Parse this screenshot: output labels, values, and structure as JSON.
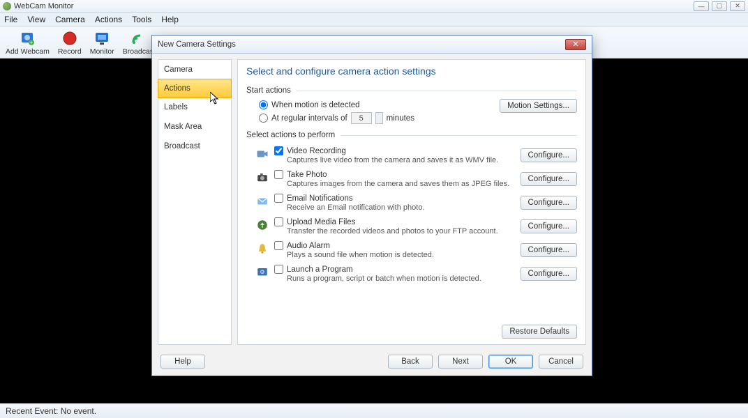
{
  "window": {
    "title": "WebCam Monitor"
  },
  "menu": {
    "file": "File",
    "view": "View",
    "camera": "Camera",
    "actions": "Actions",
    "tools": "Tools",
    "help": "Help"
  },
  "toolbar": {
    "add_webcam": "Add Webcam",
    "record": "Record",
    "monitor": "Monitor",
    "broadcast": "Broadcast"
  },
  "statusbar": {
    "recent_event": "Recent Event: No event."
  },
  "dialog": {
    "title": "New Camera Settings",
    "nav": {
      "camera": "Camera",
      "actions": "Actions",
      "labels": "Labels",
      "mask_area": "Mask Area",
      "broadcast": "Broadcast"
    },
    "heading": "Select and configure camera action settings",
    "start_actions_label": "Start actions",
    "radio_motion": "When motion is detected",
    "radio_interval_prefix": "At regular intervals of",
    "interval_value": "5",
    "radio_interval_suffix": "minutes",
    "motion_settings_btn": "Motion Settings...",
    "select_actions_label": "Select actions to perform",
    "configure_btn": "Configure...",
    "actions_list": [
      {
        "title": "Video Recording",
        "desc": "Captures live video from the camera and saves it as WMV file.",
        "checked": true
      },
      {
        "title": "Take Photo",
        "desc": "Captures images from the camera and saves them as JPEG files.",
        "checked": false
      },
      {
        "title": "Email Notifications",
        "desc": "Receive an Email notification with photo.",
        "checked": false
      },
      {
        "title": "Upload Media Files",
        "desc": "Transfer the recorded videos and photos to your FTP account.",
        "checked": false
      },
      {
        "title": "Audio Alarm",
        "desc": "Plays a sound file when motion is detected.",
        "checked": false
      },
      {
        "title": "Launch a Program",
        "desc": "Runs a program, script or batch when motion is detected.",
        "checked": false
      }
    ],
    "restore_defaults": "Restore Defaults",
    "buttons": {
      "help": "Help",
      "back": "Back",
      "next": "Next",
      "ok": "OK",
      "cancel": "Cancel"
    }
  }
}
